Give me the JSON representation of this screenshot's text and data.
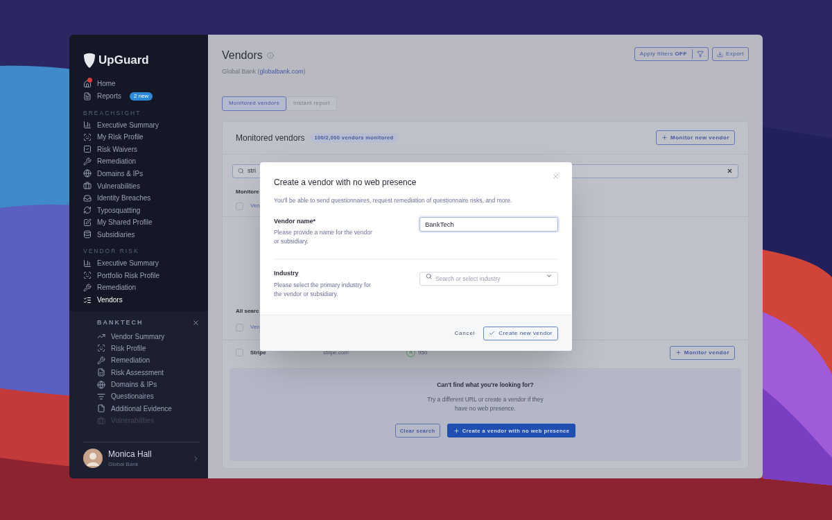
{
  "sidebar": {
    "logo": "UpGuard",
    "top_items": [
      {
        "label": "Home",
        "notification": true
      },
      {
        "label": "Reports",
        "badge": "2 new"
      }
    ],
    "sections": [
      {
        "heading": "BREACHSIGHT",
        "items": [
          {
            "label": "Executive Summary",
            "selected": false
          },
          {
            "label": "My Risk Profile",
            "selected": false
          },
          {
            "label": "Risk Waivers",
            "selected": false
          },
          {
            "label": "Remediation",
            "selected": false
          },
          {
            "label": "Domains & IPs",
            "selected": false
          },
          {
            "label": "Vulnerabilities",
            "selected": false
          },
          {
            "label": "Identity Breaches",
            "selected": false
          },
          {
            "label": "Typosquatting",
            "selected": false
          },
          {
            "label": "My Shared Profile",
            "selected": false
          },
          {
            "label": "Subsidiaries",
            "selected": false
          }
        ]
      },
      {
        "heading": "VENDOR RISK",
        "items": [
          {
            "label": "Executive Summary",
            "selected": false
          },
          {
            "label": "Portfolio Risk Profile",
            "selected": false
          },
          {
            "label": "Remediation",
            "selected": false
          },
          {
            "label": "Vendors",
            "selected": true
          }
        ]
      }
    ],
    "vendor_panel": {
      "title": "BANKTECH",
      "items": [
        {
          "label": "Vendor Summary",
          "disabled": false
        },
        {
          "label": "Risk Profile",
          "disabled": false
        },
        {
          "label": "Remediation",
          "disabled": false
        },
        {
          "label": "Risk Assessment",
          "disabled": false
        },
        {
          "label": "Domains & IPs",
          "disabled": false
        },
        {
          "label": "Questionaires",
          "disabled": false
        },
        {
          "label": "Additional Evidence",
          "disabled": false
        },
        {
          "label": "Vulnerabilities",
          "disabled": true
        }
      ]
    },
    "user": {
      "name": "Monica Hall",
      "org": "Global Bank"
    }
  },
  "header": {
    "title": "Vendors",
    "subtitle": {
      "prefix": "Global Bank (",
      "link": "globalbank.com",
      "suffix": ")"
    },
    "filter_button": "Apply filters **OFF**",
    "export_button": "Export"
  },
  "tabs": [
    {
      "label": "Monitored vendors",
      "selected": true
    },
    {
      "label": "Instant report",
      "selected": false
    }
  ],
  "card": {
    "title": "Monitored vendors",
    "badge": "100/2,000 vendors monitored",
    "button": "Monitor new vendor",
    "search": {
      "value": "stri"
    },
    "monitored_label": "Monitore",
    "monitored_header": "Ven",
    "monitored_checked": false,
    "all_label": "All searc",
    "all_header": "Ven",
    "all_checked": false,
    "rows": [
      {
        "checked": false,
        "name": "Stripe",
        "domain": "stripe.com",
        "grade": "A",
        "score": "950",
        "action": "Monitor vendor"
      }
    ],
    "empty_state": {
      "title": "Can't find what you're looking for?",
      "text": "Try a different URL or create a vendor if they have no web presence.",
      "secondary": "Clear search",
      "primary": "Create a vendor with no web presence"
    }
  },
  "modal": {
    "title": "Create a vendor with no web presence",
    "description": "You'll be able to send questionnaires, request remediation of questionnaire risks, and more.",
    "fields": [
      {
        "kind": "text",
        "label": "Vendor name*",
        "help": "Please provide a name for the vendor or subsidiary.",
        "value": "BankTech"
      },
      {
        "kind": "select",
        "label": "Industry",
        "help": "Please select the primary industry for the vendor or subsidiary.",
        "placeholder": "Search or select industry"
      }
    ],
    "cancel": "Cancel",
    "submit": "Create new vendor"
  }
}
